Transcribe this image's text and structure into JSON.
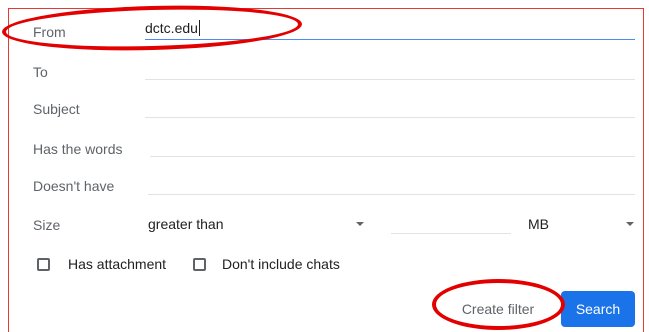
{
  "filter_form": {
    "from": {
      "label": "From",
      "value": "dctc.edu"
    },
    "to": {
      "label": "To",
      "value": ""
    },
    "subject": {
      "label": "Subject",
      "value": ""
    },
    "has_words": {
      "label": "Has the words",
      "value": ""
    },
    "doesnt_have": {
      "label": "Doesn't have",
      "value": ""
    },
    "size": {
      "label": "Size",
      "comparator": "greater than",
      "value": "",
      "unit": "MB"
    },
    "has_attachment": {
      "label": "Has attachment",
      "checked": false
    },
    "dont_include_chats": {
      "label": "Don't include chats",
      "checked": false
    }
  },
  "buttons": {
    "create_filter": "Create filter",
    "search": "Search"
  },
  "colors": {
    "accent_blue": "#1a73e8",
    "annotation_red": "#e30000"
  }
}
